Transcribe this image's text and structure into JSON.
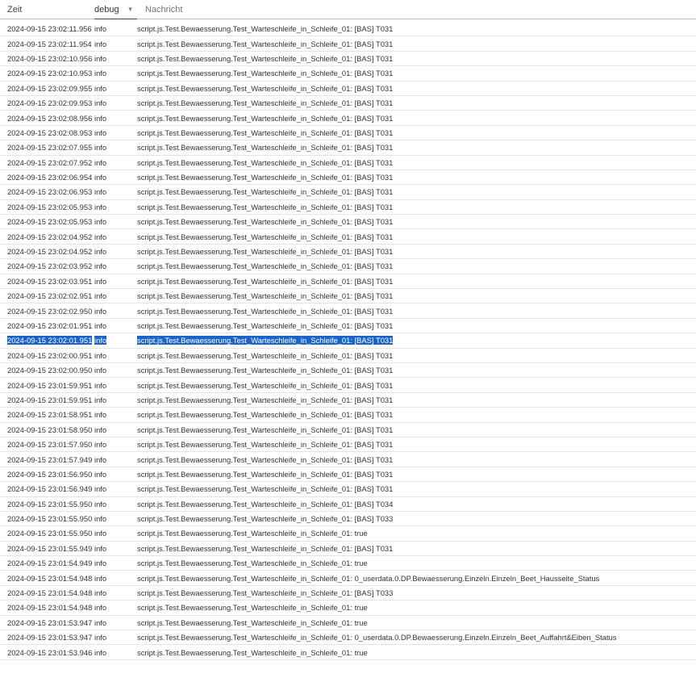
{
  "header": {
    "col_time": "Zeit",
    "col_level": "debug",
    "col_message": "Nachricht",
    "level_dropdown_icon": "chevron-down-icon"
  },
  "colors": {
    "selection": "#1a64c9",
    "row_border": "#e4e4e4"
  },
  "rows": [
    {
      "time": "2024-09-15 23:02:11.956",
      "level": "info",
      "message": "script.js.Test.Bewaesserung.Test_Warteschleife_in_Schleife_01: [BAS] T031"
    },
    {
      "time": "2024-09-15 23:02:11.954",
      "level": "info",
      "message": "script.js.Test.Bewaesserung.Test_Warteschleife_in_Schleife_01: [BAS] T031"
    },
    {
      "time": "2024-09-15 23:02:10.956",
      "level": "info",
      "message": "script.js.Test.Bewaesserung.Test_Warteschleife_in_Schleife_01: [BAS] T031"
    },
    {
      "time": "2024-09-15 23:02:10.953",
      "level": "info",
      "message": "script.js.Test.Bewaesserung.Test_Warteschleife_in_Schleife_01: [BAS] T031"
    },
    {
      "time": "2024-09-15 23:02:09.955",
      "level": "info",
      "message": "script.js.Test.Bewaesserung.Test_Warteschleife_in_Schleife_01: [BAS] T031"
    },
    {
      "time": "2024-09-15 23:02:09.953",
      "level": "info",
      "message": "script.js.Test.Bewaesserung.Test_Warteschleife_in_Schleife_01: [BAS] T031"
    },
    {
      "time": "2024-09-15 23:02:08.956",
      "level": "info",
      "message": "script.js.Test.Bewaesserung.Test_Warteschleife_in_Schleife_01: [BAS] T031"
    },
    {
      "time": "2024-09-15 23:02:08.953",
      "level": "info",
      "message": "script.js.Test.Bewaesserung.Test_Warteschleife_in_Schleife_01: [BAS] T031"
    },
    {
      "time": "2024-09-15 23:02:07.955",
      "level": "info",
      "message": "script.js.Test.Bewaesserung.Test_Warteschleife_in_Schleife_01: [BAS] T031"
    },
    {
      "time": "2024-09-15 23:02:07.952",
      "level": "info",
      "message": "script.js.Test.Bewaesserung.Test_Warteschleife_in_Schleife_01: [BAS] T031"
    },
    {
      "time": "2024-09-15 23:02:06.954",
      "level": "info",
      "message": "script.js.Test.Bewaesserung.Test_Warteschleife_in_Schleife_01: [BAS] T031"
    },
    {
      "time": "2024-09-15 23:02:06.953",
      "level": "info",
      "message": "script.js.Test.Bewaesserung.Test_Warteschleife_in_Schleife_01: [BAS] T031"
    },
    {
      "time": "2024-09-15 23:02:05.953",
      "level": "info",
      "message": "script.js.Test.Bewaesserung.Test_Warteschleife_in_Schleife_01: [BAS] T031"
    },
    {
      "time": "2024-09-15 23:02:05.953",
      "level": "info",
      "message": "script.js.Test.Bewaesserung.Test_Warteschleife_in_Schleife_01: [BAS] T031"
    },
    {
      "time": "2024-09-15 23:02:04.952",
      "level": "info",
      "message": "script.js.Test.Bewaesserung.Test_Warteschleife_in_Schleife_01: [BAS] T031"
    },
    {
      "time": "2024-09-15 23:02:04.952",
      "level": "info",
      "message": "script.js.Test.Bewaesserung.Test_Warteschleife_in_Schleife_01: [BAS] T031"
    },
    {
      "time": "2024-09-15 23:02:03.952",
      "level": "info",
      "message": "script.js.Test.Bewaesserung.Test_Warteschleife_in_Schleife_01: [BAS] T031"
    },
    {
      "time": "2024-09-15 23:02:03.951",
      "level": "info",
      "message": "script.js.Test.Bewaesserung.Test_Warteschleife_in_Schleife_01: [BAS] T031"
    },
    {
      "time": "2024-09-15 23:02:02.951",
      "level": "info",
      "message": "script.js.Test.Bewaesserung.Test_Warteschleife_in_Schleife_01: [BAS] T031"
    },
    {
      "time": "2024-09-15 23:02:02.950",
      "level": "info",
      "message": "script.js.Test.Bewaesserung.Test_Warteschleife_in_Schleife_01: [BAS] T031"
    },
    {
      "time": "2024-09-15 23:02:01.951",
      "level": "info",
      "message": "script.js.Test.Bewaesserung.Test_Warteschleife_in_Schleife_01: [BAS] T031"
    },
    {
      "time": "2024-09-15 23:02:01.951",
      "level": "info",
      "message": "script.js.Test.Bewaesserung.Test_Warteschleife_in_Schleife_01: [BAS] T031",
      "selected": true
    },
    {
      "time": "2024-09-15 23:02:00.951",
      "level": "info",
      "message": "script.js.Test.Bewaesserung.Test_Warteschleife_in_Schleife_01: [BAS] T031"
    },
    {
      "time": "2024-09-15 23:02:00.950",
      "level": "info",
      "message": "script.js.Test.Bewaesserung.Test_Warteschleife_in_Schleife_01: [BAS] T031"
    },
    {
      "time": "2024-09-15 23:01:59.951",
      "level": "info",
      "message": "script.js.Test.Bewaesserung.Test_Warteschleife_in_Schleife_01: [BAS] T031"
    },
    {
      "time": "2024-09-15 23:01:59.951",
      "level": "info",
      "message": "script.js.Test.Bewaesserung.Test_Warteschleife_in_Schleife_01: [BAS] T031"
    },
    {
      "time": "2024-09-15 23:01:58.951",
      "level": "info",
      "message": "script.js.Test.Bewaesserung.Test_Warteschleife_in_Schleife_01: [BAS] T031"
    },
    {
      "time": "2024-09-15 23:01:58.950",
      "level": "info",
      "message": "script.js.Test.Bewaesserung.Test_Warteschleife_in_Schleife_01: [BAS] T031"
    },
    {
      "time": "2024-09-15 23:01:57.950",
      "level": "info",
      "message": "script.js.Test.Bewaesserung.Test_Warteschleife_in_Schleife_01: [BAS] T031"
    },
    {
      "time": "2024-09-15 23:01:57.949",
      "level": "info",
      "message": "script.js.Test.Bewaesserung.Test_Warteschleife_in_Schleife_01: [BAS] T031"
    },
    {
      "time": "2024-09-15 23:01:56.950",
      "level": "info",
      "message": "script.js.Test.Bewaesserung.Test_Warteschleife_in_Schleife_01: [BAS] T031"
    },
    {
      "time": "2024-09-15 23:01:56.949",
      "level": "info",
      "message": "script.js.Test.Bewaesserung.Test_Warteschleife_in_Schleife_01: [BAS] T031"
    },
    {
      "time": "2024-09-15 23:01:55.950",
      "level": "info",
      "message": "script.js.Test.Bewaesserung.Test_Warteschleife_in_Schleife_01: [BAS] T034"
    },
    {
      "time": "2024-09-15 23:01:55.950",
      "level": "info",
      "message": "script.js.Test.Bewaesserung.Test_Warteschleife_in_Schleife_01: [BAS] T033"
    },
    {
      "time": "2024-09-15 23:01:55.950",
      "level": "info",
      "message": "script.js.Test.Bewaesserung.Test_Warteschleife_in_Schleife_01: true"
    },
    {
      "time": "2024-09-15 23:01:55.949",
      "level": "info",
      "message": "script.js.Test.Bewaesserung.Test_Warteschleife_in_Schleife_01: [BAS] T031"
    },
    {
      "time": "2024-09-15 23:01:54.949",
      "level": "info",
      "message": "script.js.Test.Bewaesserung.Test_Warteschleife_in_Schleife_01: true"
    },
    {
      "time": "2024-09-15 23:01:54.948",
      "level": "info",
      "message": "script.js.Test.Bewaesserung.Test_Warteschleife_in_Schleife_01: 0_userdata.0.DP.Bewaesserung.Einzeln.Einzeln_Beet_Hausseite_Status"
    },
    {
      "time": "2024-09-15 23:01:54.948",
      "level": "info",
      "message": "script.js.Test.Bewaesserung.Test_Warteschleife_in_Schleife_01: [BAS] T033"
    },
    {
      "time": "2024-09-15 23:01:54.948",
      "level": "info",
      "message": "script.js.Test.Bewaesserung.Test_Warteschleife_in_Schleife_01: true"
    },
    {
      "time": "2024-09-15 23:01:53.947",
      "level": "info",
      "message": "script.js.Test.Bewaesserung.Test_Warteschleife_in_Schleife_01: true"
    },
    {
      "time": "2024-09-15 23:01:53.947",
      "level": "info",
      "message": "script.js.Test.Bewaesserung.Test_Warteschleife_in_Schleife_01: 0_userdata.0.DP.Bewaesserung.Einzeln.Einzeln_Beet_Auffahrt&Eiben_Status"
    },
    {
      "time": "2024-09-15 23:01:53.946",
      "level": "info",
      "message": "script.js.Test.Bewaesserung.Test_Warteschleife_in_Schleife_01: true"
    }
  ]
}
